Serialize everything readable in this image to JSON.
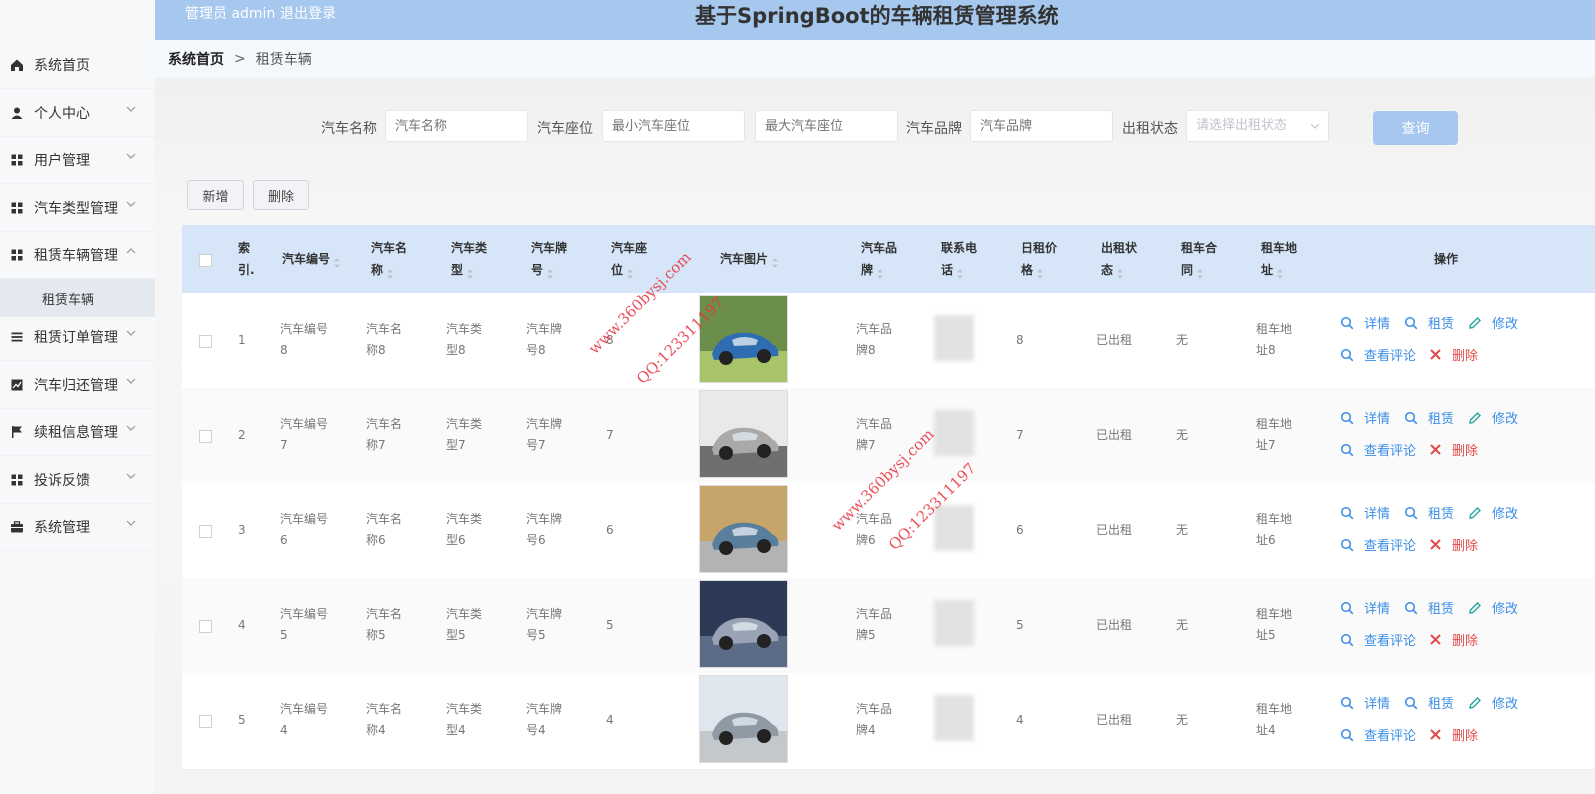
{
  "header": {
    "user": "管理员 admin",
    "logout": "退出登录",
    "title": "基于SpringBoot的车辆租赁管理系统"
  },
  "sidebar": {
    "items": [
      {
        "label": "系统首页",
        "icon": "home-icon"
      },
      {
        "label": "个人中心",
        "icon": "user-icon"
      },
      {
        "label": "用户管理",
        "icon": "grid-icon"
      },
      {
        "label": "汽车类型管理",
        "icon": "grid-icon"
      },
      {
        "label": "租赁车辆管理",
        "icon": "grid-icon"
      },
      {
        "label": "租赁订单管理",
        "icon": "list-icon"
      },
      {
        "label": "汽车归还管理",
        "icon": "chart-icon"
      },
      {
        "label": "续租信息管理",
        "icon": "flag-icon"
      },
      {
        "label": "投诉反馈",
        "icon": "grid-icon"
      },
      {
        "label": "系统管理",
        "icon": "briefcase-icon"
      }
    ],
    "active_sub": "租赁车辆"
  },
  "breadcrumb": {
    "home": "系统首页",
    "separator": ">",
    "current": "租赁车辆"
  },
  "search": {
    "car_name_label": "汽车名称",
    "car_name_placeholder": "汽车名称",
    "seat_label": "汽车座位",
    "seat_min_placeholder": "最小汽车座位",
    "seat_max_placeholder": "最大汽车座位",
    "brand_label": "汽车品牌",
    "brand_placeholder": "汽车品牌",
    "status_label": "出租状态",
    "status_placeholder": "请选择出租状态",
    "query_button": "查询"
  },
  "toolbar": {
    "add": "新增",
    "delete": "删除"
  },
  "table": {
    "headers": {
      "index": [
        "索",
        "引."
      ],
      "car_no": [
        "汽车编号"
      ],
      "car_name": [
        "汽车名",
        "称"
      ],
      "car_type": [
        "汽车类",
        "型"
      ],
      "plate": [
        "汽车牌",
        "号"
      ],
      "seats": [
        "汽车座",
        "位"
      ],
      "image": [
        "汽车图片"
      ],
      "brand": [
        "汽车品",
        "牌"
      ],
      "phone": [
        "联系电",
        "话"
      ],
      "price": [
        "日租价",
        "格"
      ],
      "status": [
        "出租状",
        "态"
      ],
      "contract": [
        "租车合",
        "同"
      ],
      "address": [
        "租车地",
        "址"
      ],
      "ops": [
        "操作"
      ]
    },
    "rows": [
      {
        "index": "1",
        "car_no": [
          "汽车编号",
          "8"
        ],
        "car_name": [
          "汽车名",
          "称8"
        ],
        "car_type": [
          "汽车类",
          "型8"
        ],
        "plate": [
          "汽车牌",
          "号8"
        ],
        "seats": "8",
        "brand": [
          "汽车品",
          "牌8"
        ],
        "price": "8",
        "status": "已出租",
        "contract": "无",
        "address": [
          "租车地",
          "址8"
        ]
      },
      {
        "index": "2",
        "car_no": [
          "汽车编号",
          "7"
        ],
        "car_name": [
          "汽车名",
          "称7"
        ],
        "car_type": [
          "汽车类",
          "型7"
        ],
        "plate": [
          "汽车牌",
          "号7"
        ],
        "seats": "7",
        "brand": [
          "汽车品",
          "牌7"
        ],
        "price": "7",
        "status": "已出租",
        "contract": "无",
        "address": [
          "租车地",
          "址7"
        ]
      },
      {
        "index": "3",
        "car_no": [
          "汽车编号",
          "6"
        ],
        "car_name": [
          "汽车名",
          "称6"
        ],
        "car_type": [
          "汽车类",
          "型6"
        ],
        "plate": [
          "汽车牌",
          "号6"
        ],
        "seats": "6",
        "brand": [
          "汽车品",
          "牌6"
        ],
        "price": "6",
        "status": "已出租",
        "contract": "无",
        "address": [
          "租车地",
          "址6"
        ]
      },
      {
        "index": "4",
        "car_no": [
          "汽车编号",
          "5"
        ],
        "car_name": [
          "汽车名",
          "称5"
        ],
        "car_type": [
          "汽车类",
          "型5"
        ],
        "plate": [
          "汽车牌",
          "号5"
        ],
        "seats": "5",
        "brand": [
          "汽车品",
          "牌5"
        ],
        "price": "5",
        "status": "已出租",
        "contract": "无",
        "address": [
          "租车地",
          "址5"
        ]
      },
      {
        "index": "5",
        "car_no": [
          "汽车编号",
          "4"
        ],
        "car_name": [
          "汽车名",
          "称4"
        ],
        "car_type": [
          "汽车类",
          "型4"
        ],
        "plate": [
          "汽车牌",
          "号4"
        ],
        "seats": "4",
        "brand": [
          "汽车品",
          "牌4"
        ],
        "price": "4",
        "status": "已出租",
        "contract": "无",
        "address": [
          "租车地",
          "址4"
        ]
      }
    ],
    "row_actions": {
      "detail": "详情",
      "rent": "租赁",
      "edit": "修改",
      "comments": "查看评论",
      "delete": "删除"
    }
  },
  "watermarks": {
    "site": "www.360bysj.com",
    "qq": "QQ:123311197"
  },
  "colors": {
    "header_bg": "#a6c7ee",
    "table_head_bg": "#d6e6f8",
    "link": "#3a8ee6",
    "danger": "#e04a4a",
    "watermark": "#e8323f"
  }
}
